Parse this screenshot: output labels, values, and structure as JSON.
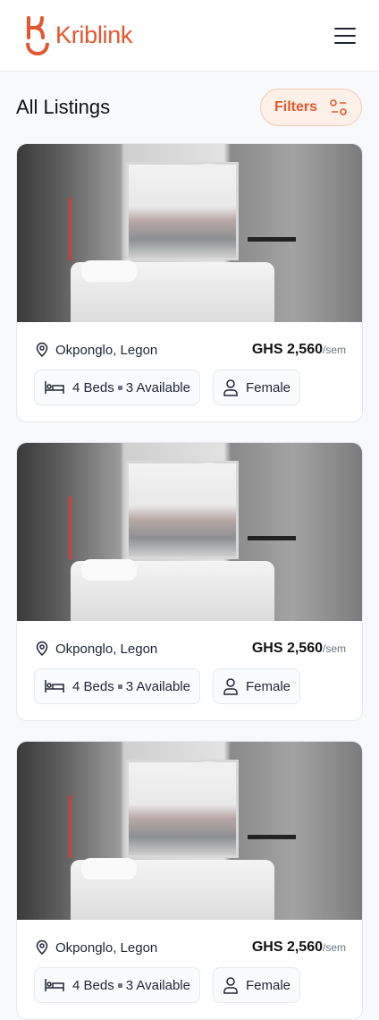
{
  "header": {
    "brand": "Kriblink",
    "brand_color": "#e4572e",
    "menu_icon": "hamburger-icon"
  },
  "page": {
    "title": "All Listings",
    "filters_label": "Filters",
    "filters_icon": "sliders-icon"
  },
  "listings": [
    {
      "location": "Okponglo, Legon",
      "price": "GHS 2,560",
      "period": "/sem",
      "beds": "4 Beds",
      "available": "3 Available",
      "gender": "Female"
    },
    {
      "location": "Okponglo, Legon",
      "price": "GHS 2,560",
      "period": "/sem",
      "beds": "4 Beds",
      "available": "3 Available",
      "gender": "Female"
    },
    {
      "location": "Okponglo, Legon",
      "price": "GHS 2,560",
      "period": "/sem",
      "beds": "4 Beds",
      "available": "3 Available",
      "gender": "Female"
    }
  ]
}
